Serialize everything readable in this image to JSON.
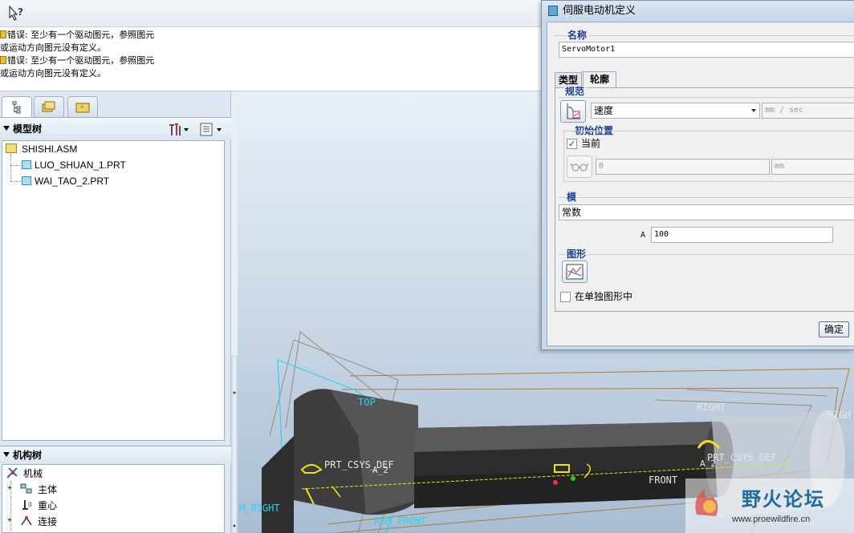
{
  "toolbar": {
    "help_icon": "context-help-icon"
  },
  "messages": [
    "错误: 至少有一个驱动图元，参照图元",
    "或运动方向图元没有定义。",
    "错误: 至少有一个驱动图元，参照图元",
    "或运动方向图元没有定义。"
  ],
  "navigator": {
    "tabs": [
      "model-tree-tab-icon",
      "folder-browser-tab-icon",
      "favorites-tab-icon"
    ],
    "model_tree_title": "模型树",
    "tree": {
      "root": "SHISHI.ASM",
      "children": [
        "LUO_SHUAN_1.PRT",
        "WAI_TAO_2.PRT"
      ]
    },
    "mech_tree_title": "机构树",
    "mech_tree": {
      "root": "机械",
      "items": [
        "主体",
        "重心",
        "连接"
      ]
    }
  },
  "dialog": {
    "title": "伺服电动机定义",
    "name_group": "名称",
    "name_value": "ServoMotor1",
    "tabs": [
      "类型",
      "轮廓"
    ],
    "active_tab": "轮廓",
    "spec_group": "规范",
    "spec_select": "速度",
    "spec_unit": "mm / sec",
    "initial_group": "初始位置",
    "current_label": "当前",
    "current_checked": true,
    "initial_value": "0",
    "initial_unit": "mm",
    "module_group": "模",
    "module_select": "常数",
    "a_label": "A",
    "a_value": "100",
    "graph_group": "图形",
    "separate_graph_label": "在单独图形中",
    "separate_graph_checked": false,
    "ok_label": "确定"
  },
  "graphics": {
    "labels": [
      "TOP",
      "RIGHT",
      "RIGH",
      "PRT_CSYS_DEF",
      "PRT_CSYS_DEF",
      "A_2",
      "A_2",
      "FRONT",
      "ASM_FRONT",
      "M_RIGHT"
    ]
  },
  "watermark": {
    "text": "野火论坛",
    "url": "www.proewildfire.cn"
  },
  "colors": {
    "datum_cyan": "#2ad4f0",
    "datum_brown": "#b07a3c",
    "accent_yellow": "#f2e21a"
  }
}
